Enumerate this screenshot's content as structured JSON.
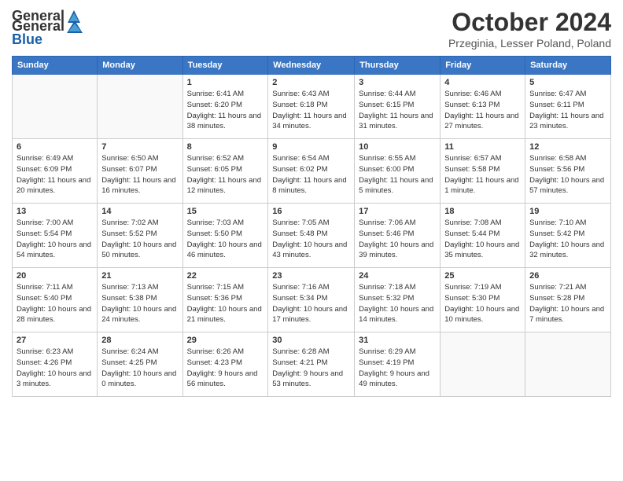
{
  "logo": {
    "general": "General",
    "blue": "Blue"
  },
  "header": {
    "month": "October 2024",
    "location": "Przeginia, Lesser Poland, Poland"
  },
  "weekdays": [
    "Sunday",
    "Monday",
    "Tuesday",
    "Wednesday",
    "Thursday",
    "Friday",
    "Saturday"
  ],
  "weeks": [
    [
      {
        "num": "",
        "empty": true
      },
      {
        "num": "",
        "empty": true
      },
      {
        "num": "1",
        "sunrise": "6:41 AM",
        "sunset": "6:20 PM",
        "daylight": "11 hours and 38 minutes."
      },
      {
        "num": "2",
        "sunrise": "6:43 AM",
        "sunset": "6:18 PM",
        "daylight": "11 hours and 34 minutes."
      },
      {
        "num": "3",
        "sunrise": "6:44 AM",
        "sunset": "6:15 PM",
        "daylight": "11 hours and 31 minutes."
      },
      {
        "num": "4",
        "sunrise": "6:46 AM",
        "sunset": "6:13 PM",
        "daylight": "11 hours and 27 minutes."
      },
      {
        "num": "5",
        "sunrise": "6:47 AM",
        "sunset": "6:11 PM",
        "daylight": "11 hours and 23 minutes."
      }
    ],
    [
      {
        "num": "6",
        "sunrise": "6:49 AM",
        "sunset": "6:09 PM",
        "daylight": "11 hours and 20 minutes."
      },
      {
        "num": "7",
        "sunrise": "6:50 AM",
        "sunset": "6:07 PM",
        "daylight": "11 hours and 16 minutes."
      },
      {
        "num": "8",
        "sunrise": "6:52 AM",
        "sunset": "6:05 PM",
        "daylight": "11 hours and 12 minutes."
      },
      {
        "num": "9",
        "sunrise": "6:54 AM",
        "sunset": "6:02 PM",
        "daylight": "11 hours and 8 minutes."
      },
      {
        "num": "10",
        "sunrise": "6:55 AM",
        "sunset": "6:00 PM",
        "daylight": "11 hours and 5 minutes."
      },
      {
        "num": "11",
        "sunrise": "6:57 AM",
        "sunset": "5:58 PM",
        "daylight": "11 hours and 1 minute."
      },
      {
        "num": "12",
        "sunrise": "6:58 AM",
        "sunset": "5:56 PM",
        "daylight": "10 hours and 57 minutes."
      }
    ],
    [
      {
        "num": "13",
        "sunrise": "7:00 AM",
        "sunset": "5:54 PM",
        "daylight": "10 hours and 54 minutes."
      },
      {
        "num": "14",
        "sunrise": "7:02 AM",
        "sunset": "5:52 PM",
        "daylight": "10 hours and 50 minutes."
      },
      {
        "num": "15",
        "sunrise": "7:03 AM",
        "sunset": "5:50 PM",
        "daylight": "10 hours and 46 minutes."
      },
      {
        "num": "16",
        "sunrise": "7:05 AM",
        "sunset": "5:48 PM",
        "daylight": "10 hours and 43 minutes."
      },
      {
        "num": "17",
        "sunrise": "7:06 AM",
        "sunset": "5:46 PM",
        "daylight": "10 hours and 39 minutes."
      },
      {
        "num": "18",
        "sunrise": "7:08 AM",
        "sunset": "5:44 PM",
        "daylight": "10 hours and 35 minutes."
      },
      {
        "num": "19",
        "sunrise": "7:10 AM",
        "sunset": "5:42 PM",
        "daylight": "10 hours and 32 minutes."
      }
    ],
    [
      {
        "num": "20",
        "sunrise": "7:11 AM",
        "sunset": "5:40 PM",
        "daylight": "10 hours and 28 minutes."
      },
      {
        "num": "21",
        "sunrise": "7:13 AM",
        "sunset": "5:38 PM",
        "daylight": "10 hours and 24 minutes."
      },
      {
        "num": "22",
        "sunrise": "7:15 AM",
        "sunset": "5:36 PM",
        "daylight": "10 hours and 21 minutes."
      },
      {
        "num": "23",
        "sunrise": "7:16 AM",
        "sunset": "5:34 PM",
        "daylight": "10 hours and 17 minutes."
      },
      {
        "num": "24",
        "sunrise": "7:18 AM",
        "sunset": "5:32 PM",
        "daylight": "10 hours and 14 minutes."
      },
      {
        "num": "25",
        "sunrise": "7:19 AM",
        "sunset": "5:30 PM",
        "daylight": "10 hours and 10 minutes."
      },
      {
        "num": "26",
        "sunrise": "7:21 AM",
        "sunset": "5:28 PM",
        "daylight": "10 hours and 7 minutes."
      }
    ],
    [
      {
        "num": "27",
        "sunrise": "6:23 AM",
        "sunset": "4:26 PM",
        "daylight": "10 hours and 3 minutes."
      },
      {
        "num": "28",
        "sunrise": "6:24 AM",
        "sunset": "4:25 PM",
        "daylight": "10 hours and 0 minutes."
      },
      {
        "num": "29",
        "sunrise": "6:26 AM",
        "sunset": "4:23 PM",
        "daylight": "9 hours and 56 minutes."
      },
      {
        "num": "30",
        "sunrise": "6:28 AM",
        "sunset": "4:21 PM",
        "daylight": "9 hours and 53 minutes."
      },
      {
        "num": "31",
        "sunrise": "6:29 AM",
        "sunset": "4:19 PM",
        "daylight": "9 hours and 49 minutes."
      },
      {
        "num": "",
        "empty": true
      },
      {
        "num": "",
        "empty": true
      }
    ]
  ]
}
